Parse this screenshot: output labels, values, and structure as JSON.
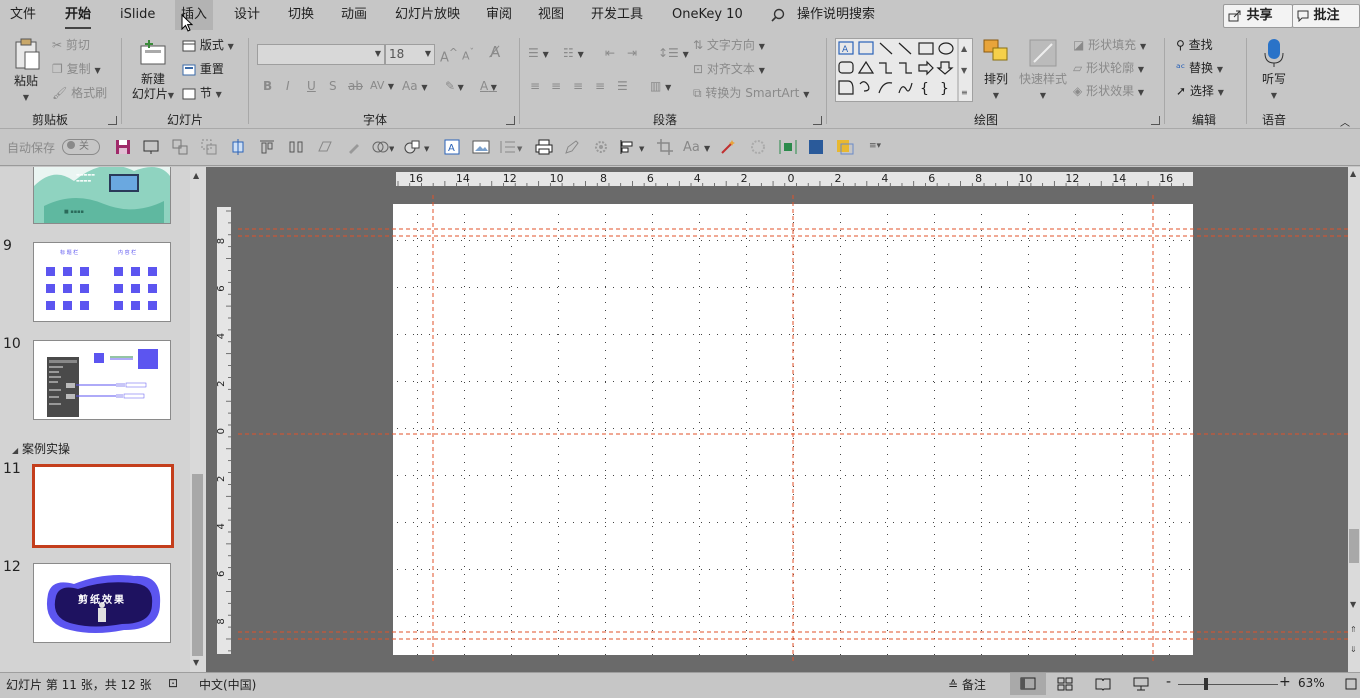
{
  "menu": {
    "tabs": [
      "文件",
      "开始",
      "iSlide",
      "插入",
      "设计",
      "切换",
      "动画",
      "幻灯片放映",
      "审阅",
      "视图",
      "开发工具",
      "OneKey 10"
    ],
    "active_tab": "开始",
    "search_label": "操作说明搜索",
    "share_label": "共享",
    "comment_label": "批注"
  },
  "ribbon": {
    "clipboard": {
      "paste": "粘贴",
      "cut": "剪切",
      "copy": "复制",
      "format_painter": "格式刷",
      "label": "剪贴板"
    },
    "slides": {
      "new_slide_line1": "新建",
      "new_slide_line2": "幻灯片",
      "layout": "版式",
      "reset": "重置",
      "section": "节",
      "label": "幻灯片"
    },
    "font": {
      "font_name": "",
      "font_size": "18",
      "label": "字体"
    },
    "paragraph": {
      "text_direction": "文字方向",
      "align_text": "对齐文本",
      "convert_smartart": "转换为 SmartArt",
      "label": "段落"
    },
    "drawing": {
      "arrange": "排列",
      "quick_styles": "快速样式",
      "shape_fill": "形状填充",
      "shape_outline": "形状轮廓",
      "shape_effects": "形状效果",
      "label": "绘图"
    },
    "editing": {
      "find": "查找",
      "replace": "替换",
      "select": "选择",
      "label": "编辑"
    },
    "voice": {
      "dictate": "听写",
      "label": "语音"
    }
  },
  "qat": {
    "autosave_label": "自动保存",
    "autosave_state": "关"
  },
  "thumbnails": {
    "slides": [
      {
        "num": "9"
      },
      {
        "num": "10"
      },
      {
        "num": "11"
      },
      {
        "num": "12"
      }
    ],
    "section_title": "案例实操",
    "selected": "11",
    "slide12_title": "剪纸效果",
    "slide9_header_left": "标 题 栏",
    "slide9_header_right": "内 容 栏"
  },
  "rulers": {
    "h_ticks": [
      "16",
      "14",
      "12",
      "10",
      "8",
      "6",
      "4",
      "2",
      "0",
      "2",
      "4",
      "6",
      "8",
      "10",
      "12",
      "14",
      "16"
    ],
    "v_ticks": [
      "8",
      "6",
      "4",
      "2",
      "0",
      "2",
      "4",
      "6",
      "8"
    ]
  },
  "status": {
    "slide_info": "幻灯片 第 11 张，共 12 张",
    "language": "中文(中国)",
    "notes": "备注",
    "zoom": "63%"
  },
  "colors": {
    "accent": "#c43e1c",
    "guide": "#e0522a",
    "thumb_purple": "#5c55f0"
  }
}
